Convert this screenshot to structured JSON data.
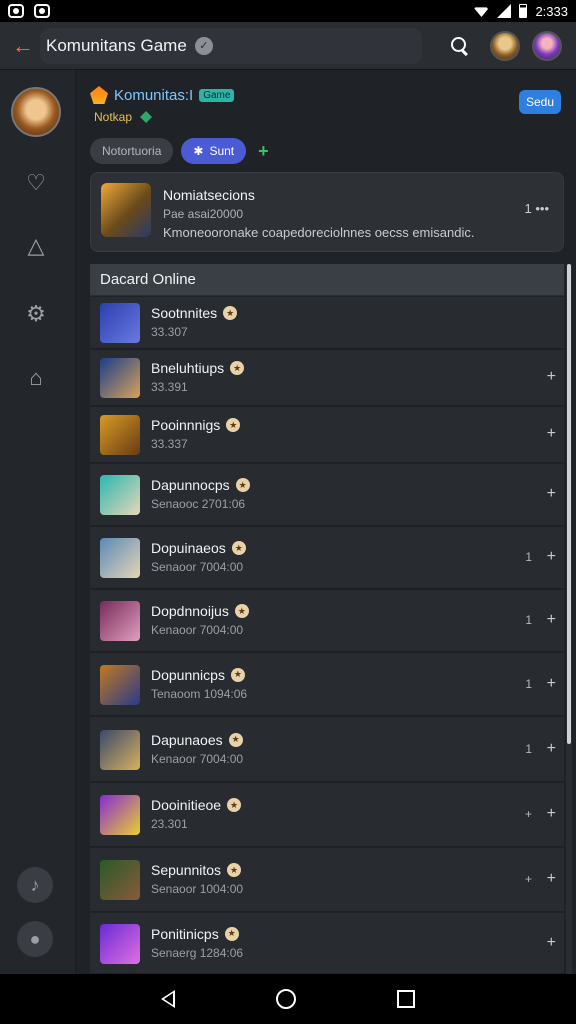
{
  "status": {
    "time": "2:333"
  },
  "topbar": {
    "title": "Komunitans Game",
    "verified_icon": "check-icon"
  },
  "header": {
    "name": "Komunitas:I",
    "tag": "Game",
    "subtitle": "Notkap",
    "chips": [
      "Notortuoria",
      "Sunt"
    ],
    "follow_label": "Sedu"
  },
  "card": {
    "title": "Nomiatsecions",
    "subtitle": "Pae asai20000",
    "desc": "Kmoneooro­nake coapedoreciolnnes oecss emisandic.",
    "meta": "1 •••"
  },
  "section": {
    "title": "Dacard Online"
  },
  "members": [
    {
      "name": "Sootnnites",
      "sub": "33.307",
      "num": "",
      "add": "",
      "c1": "#2a3fb0",
      "c2": "#6a7ae0"
    },
    {
      "name": "Bneluhtiups",
      "sub": "33.391",
      "num": "",
      "add": "+",
      "c1": "#1a3e8a",
      "c2": "#d9a25a"
    },
    {
      "name": "Pooinnnigs",
      "sub": "33.337",
      "num": "",
      "add": "+",
      "c1": "#d79c24",
      "c2": "#6a3a14"
    },
    {
      "name": "Dapunnocps",
      "sub": "Senaooc  2701:06",
      "num": "",
      "add": "+",
      "c1": "#2ab8b2",
      "c2": "#e8d6b8"
    },
    {
      "name": "Dopuinaeos",
      "sub": "Senaoor  7004:00",
      "num": "1",
      "add": "+",
      "c1": "#5a8ab8",
      "c2": "#e6d4b6"
    },
    {
      "name": "Dopdnnoijus",
      "sub": "Kenaoor  7004:00",
      "num": "1",
      "add": "+",
      "c1": "#7a2a5a",
      "c2": "#e0a0c0"
    },
    {
      "name": "Dopunnicps",
      "sub": "Tenaoom  1094:06",
      "num": "1",
      "add": "+",
      "c1": "#c07a20",
      "c2": "#2a3a8a"
    },
    {
      "name": "Dapunaoes",
      "sub": "Kenaoor  7004:00",
      "num": "1",
      "add": "+",
      "c1": "#3a4a6a",
      "c2": "#d8b060"
    },
    {
      "name": "Dooinitieoe",
      "sub": "23.301",
      "num": "+",
      "add": "+",
      "c1": "#8a2ad6",
      "c2": "#e8d030"
    },
    {
      "name": "Sepunnitos",
      "sub": "Senaoor  1004:00",
      "num": "+",
      "add": "+",
      "c1": "#2a5a2a",
      "c2": "#8a5a3a"
    },
    {
      "name": "Ponitinicps",
      "sub": "Senaerg  1284:06",
      "num": "",
      "add": "+",
      "c1": "#6a2ad6",
      "c2": "#e070e0"
    }
  ],
  "nav": {
    "back": "back",
    "home": "home",
    "recents": "recents"
  }
}
